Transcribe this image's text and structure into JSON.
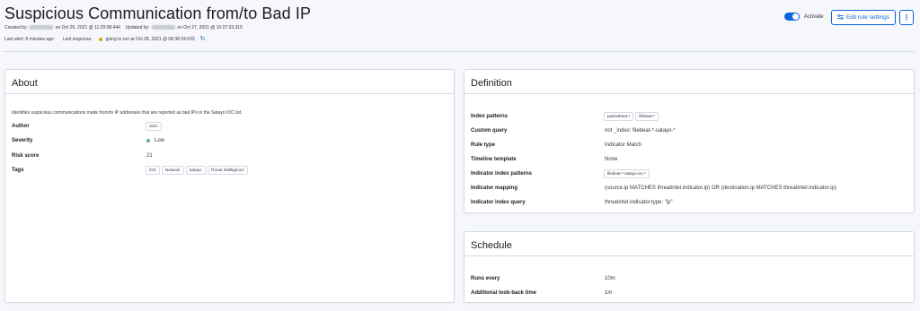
{
  "header": {
    "title": "Suspicious Communication from/to Bad IP",
    "created_by_label": "Created by:",
    "created_on": "on Oct 25, 2021 @ 11:29:08.444",
    "updated_by_label": "Updated by:",
    "updated_on": "on Oct 27, 2021 @ 15:27:33.315",
    "last_alert": "Last alert: 8 minutes ago",
    "last_response_label": "Last response:",
    "last_response_value": "going to run at Oct 28, 2021 @ 08:38:24.033",
    "activate_label": "Activate",
    "edit_button": "Edit rule settings",
    "more_button": "⋮"
  },
  "about": {
    "title": "About",
    "description": "Identifies suspicious communications made from/to IP addresses that are reported as bad IPs in the Satayo IOC list.",
    "author_label": "Author",
    "author_value": "SOC",
    "severity_label": "Severity",
    "severity_value": "Low",
    "risk_label": "Risk score",
    "risk_value": "21",
    "tags_label": "Tags",
    "tags": [
      "IOC",
      "Network",
      "Satayo",
      "Threat Intelligence"
    ]
  },
  "definition": {
    "title": "Definition",
    "index_patterns_label": "Index patterns",
    "index_patterns": [
      "packetbeat-*",
      "filebeat-*"
    ],
    "custom_query_label": "Custom query",
    "custom_query_value": "not _index: filebeat-*-satayo-*",
    "rule_type_label": "Rule type",
    "rule_type_value": "Indicator Match",
    "timeline_label": "Timeline template",
    "timeline_value": "None",
    "ind_index_label": "Indicator index patterns",
    "ind_index_value": "filebeat-*-satayo-ioc-*",
    "ind_mapping_label": "Indicator mapping",
    "ind_mapping_value": "(source.ip MATCHES threatintel.indicator.ip) OR (destination.ip MATCHES threatintel.indicator.ip)",
    "ind_query_label": "Indicator index query",
    "ind_query_value": "threatintel.indicator.type: \"ip\""
  },
  "schedule": {
    "title": "Schedule",
    "runs_every_label": "Runs every",
    "runs_every_value": "10m",
    "lookback_label": "Additional look-back time",
    "lookback_value": "1m"
  },
  "colors": {
    "accent": "#0b64dd",
    "severity_low": "#54b399",
    "warning_dot": "#d6a30c"
  }
}
